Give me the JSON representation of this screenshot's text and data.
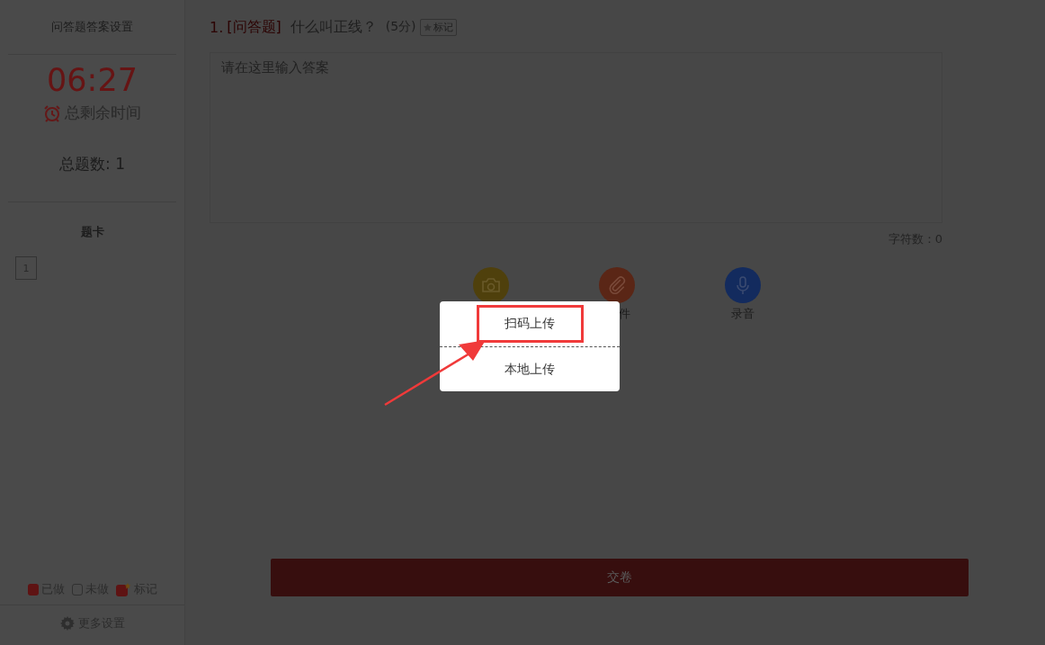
{
  "sidebar": {
    "title": "问答题答案设置",
    "timer": "06:27",
    "timer_label": "总剩余时间",
    "total": "总题数: 1",
    "card_title": "题卡",
    "cards": [
      {
        "label": "1",
        "answered": false
      }
    ],
    "legend": [
      {
        "kind": "done",
        "label": "已做"
      },
      {
        "kind": "todo",
        "label": "未做"
      },
      {
        "kind": "marked",
        "label": "标记"
      }
    ],
    "settings": "更多设置"
  },
  "question": {
    "number": "1.",
    "type": "[问答题]",
    "text": "什么叫正线？",
    "score": "(5分)",
    "mark_button": "标记"
  },
  "answer": {
    "placeholder": "请在这里输入答案",
    "char_count": "字符数：0"
  },
  "tools": [
    {
      "kind": "camera",
      "color": "#4f400c"
    },
    {
      "kind": "attachment",
      "color": "#5a2616",
      "label": "件"
    },
    {
      "kind": "mic",
      "color": "#132b5e",
      "label": "录音"
    }
  ],
  "popup": {
    "items": [
      {
        "label": "扫码上传",
        "highlighted": true
      },
      {
        "label": "本地上传",
        "highlighted": false
      }
    ]
  },
  "submit": "交卷"
}
